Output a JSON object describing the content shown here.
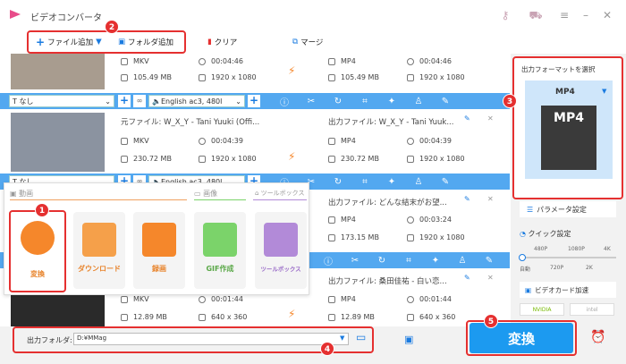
{
  "window": {
    "title": "ビデオコンバータ"
  },
  "toolbar": {
    "add_file": "ファイル追加",
    "add_folder": "フォルダ追加",
    "clear": "クリア",
    "merge": "マージ"
  },
  "files": [
    {
      "src_format": "MKV",
      "src_duration": "00:04:46",
      "src_size": "105.49 MB",
      "src_res": "1920 x 1080",
      "out_format": "MP4",
      "out_duration": "00:04:46",
      "out_size": "105.49 MB",
      "out_res": "1920 x 1080"
    },
    {
      "src_name": "元ファイル: W_X_Y - Tani Yuuki (Offi...",
      "src_format": "MKV",
      "src_duration": "00:04:39",
      "src_size": "230.72 MB",
      "src_res": "1920 x 1080",
      "out_name": "出力ファイル: W_X_Y - Tani Yuuk...",
      "out_format": "MP4",
      "out_duration": "00:04:39",
      "out_size": "230.72 MB",
      "out_res": "1920 x 1080"
    },
    {
      "out_name": "出力ファイル: どんな結末がお望...",
      "out_format": "MP4",
      "out_duration": "00:03:24",
      "out_size": "173.15 MB",
      "out_res": "1920 x 1080"
    },
    {
      "out_name": "出力ファイル: 桑田佳祐 - 白い恋...",
      "src_format": "MKV",
      "src_duration": "00:01:44",
      "src_size": "12.89 MB",
      "src_res": "640 x 360",
      "out_format": "MP4",
      "out_duration": "00:01:44",
      "out_size": "12.89 MB",
      "out_res": "640 x 360"
    }
  ],
  "trackbar": {
    "subtitle": "なし",
    "audio": "English ac3, 480l"
  },
  "popup": {
    "sections": [
      "動画",
      "画像",
      "ツールボックス"
    ],
    "tiles": [
      "変換",
      "ダウンロード",
      "録画",
      "GIF作成",
      "ツールボックス"
    ]
  },
  "right": {
    "format_title": "出力フォーマットを選択",
    "format": "MP4",
    "param": "パラメータ設定",
    "quick": "クイック設定",
    "q_labels_top": [
      "480P",
      "1080P",
      "4K"
    ],
    "q_labels_bottom": [
      "自動",
      "720P",
      "2K"
    ],
    "gpu": "ビデオカード加速",
    "nvidia": "NVIDIA",
    "intel": "intel"
  },
  "bottom": {
    "folder_label": "出力フォルダ:",
    "folder_path": "D:¥MMag",
    "convert": "変換"
  },
  "badges": [
    "1",
    "2",
    "3",
    "4",
    "5"
  ]
}
